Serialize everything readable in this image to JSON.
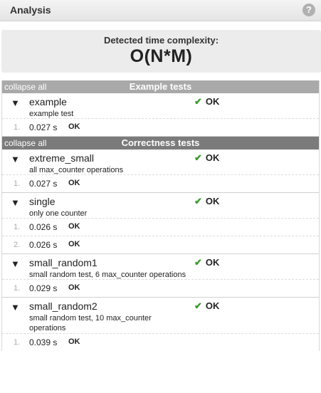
{
  "header": {
    "title": "Analysis",
    "help": "?"
  },
  "complexity": {
    "label": "Detected time complexity:",
    "value": "O(N*M)"
  },
  "groups": [
    {
      "collapse_label": "collapse all",
      "title": "Example tests",
      "tests": [
        {
          "name": "example",
          "description": "example test",
          "status": "OK",
          "runs": [
            {
              "index": "1.",
              "time": "0.027 s",
              "status": "OK"
            }
          ]
        }
      ]
    },
    {
      "collapse_label": "collapse all",
      "title": "Correctness tests",
      "tests": [
        {
          "name": "extreme_small",
          "description": "all max_counter operations",
          "status": "OK",
          "runs": [
            {
              "index": "1.",
              "time": "0.027 s",
              "status": "OK"
            }
          ]
        },
        {
          "name": "single",
          "description": "only one counter",
          "status": "OK",
          "runs": [
            {
              "index": "1.",
              "time": "0.026 s",
              "status": "OK"
            },
            {
              "index": "2.",
              "time": "0.026 s",
              "status": "OK"
            }
          ]
        },
        {
          "name": "small_random1",
          "description": "small random test, 6 max_counter operations",
          "status": "OK",
          "runs": [
            {
              "index": "1.",
              "time": "0.029 s",
              "status": "OK"
            }
          ]
        },
        {
          "name": "small_random2",
          "description": "small random test, 10 max_counter operations",
          "status": "OK",
          "runs": [
            {
              "index": "1.",
              "time": "0.039 s",
              "status": "OK"
            }
          ]
        }
      ]
    }
  ],
  "icons": {
    "expand_arrow": "▼",
    "check": "✔"
  },
  "colors": {
    "check": "#3a9a2a",
    "group_light": "#a9a9a9",
    "group_dark": "#7b7b7b"
  }
}
